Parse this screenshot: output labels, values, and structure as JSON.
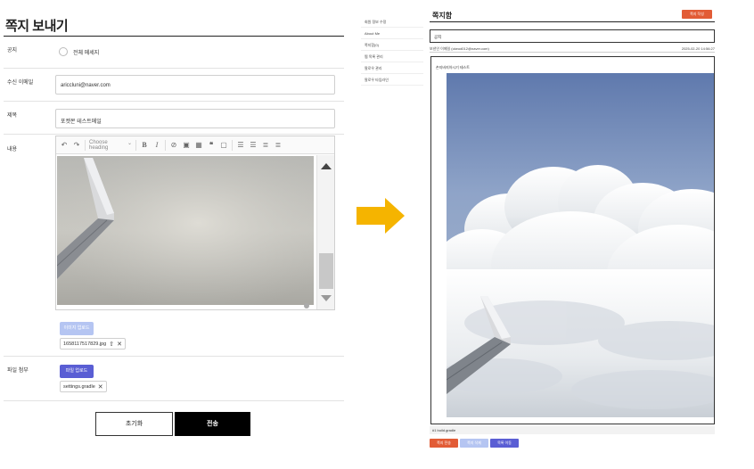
{
  "send_form": {
    "title": "쪽지 보내기",
    "notice": {
      "label": "공지",
      "option_label": "전체 메세지"
    },
    "recipient": {
      "label": "수신 이메일",
      "value": "ariccluni@naver.com"
    },
    "subject": {
      "label": "제목",
      "value": "포켓몬 테스트메일"
    },
    "content": {
      "label": "내용",
      "toolbar": {
        "undo_icon": "undo-icon",
        "redo_icon": "redo-icon",
        "heading_placeholder": "Choose heading",
        "tools": [
          "B",
          "I",
          "link",
          "image",
          "table",
          "quote",
          "media",
          "bulleted-list",
          "numbered-list",
          "outdent",
          "indent"
        ]
      },
      "upload_image_label": "이미지 업로드",
      "image_file": "1658117517829.jpg"
    },
    "attachment": {
      "label": "파일 첨부",
      "upload_label": "파일 업로드",
      "file": "settings.gradle"
    },
    "reset_label": "초기화",
    "send_label": "전송"
  },
  "arrow": {
    "color": "#f5b400"
  },
  "menu": {
    "items": [
      "회원 정보 수정",
      "About Me",
      "쪽지함(0)",
      "찜 목록 관리",
      "팔로우 관리",
      "팔로우 타임라인"
    ]
  },
  "mailbox": {
    "title": "쪽지함",
    "write_button": "쪽지 작성",
    "subject": "공지",
    "sender": "보낸인 이메일 (ckeod012@naver.com)",
    "timestamp": "2025-02-20 14:56:27",
    "body_text": "손지바지아시기 테스트",
    "attachment": "#1 build.gradle",
    "buttons": {
      "reply": "쪽지 전송",
      "delete": "쪽지 삭제",
      "list": "목록 이동"
    }
  },
  "colors": {
    "accent_orange": "#e25c36",
    "accent_purple": "#5a5ed4",
    "accent_light_blue": "#b5c5f2",
    "arrow": "#f5b400"
  }
}
